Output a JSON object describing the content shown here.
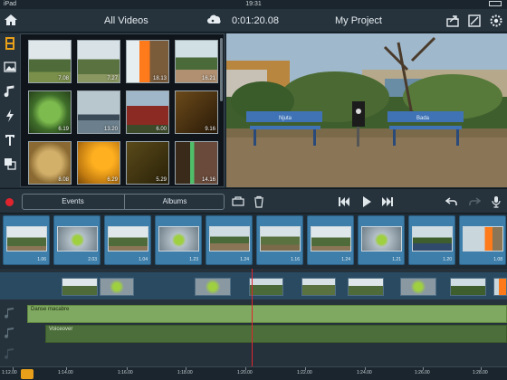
{
  "status": {
    "carrier": "iPad",
    "time": "19:31"
  },
  "titlebar": {
    "library_title": "All Videos",
    "timecode": "0:01:20.08",
    "project_title": "My Project"
  },
  "media": {
    "items": [
      {
        "duration": "7.08"
      },
      {
        "duration": "7.27"
      },
      {
        "duration": "18.13"
      },
      {
        "duration": "16.21"
      },
      {
        "duration": "6.19"
      },
      {
        "duration": "13.20"
      },
      {
        "duration": "6.00"
      },
      {
        "duration": "9.16"
      },
      {
        "duration": "8.08"
      },
      {
        "duration": "6.29"
      },
      {
        "duration": "5.29"
      },
      {
        "duration": "14.16"
      }
    ]
  },
  "preview": {
    "sign_left": "Njuta",
    "sign_right": "Bada"
  },
  "controls": {
    "events_label": "Events",
    "albums_label": "Albums"
  },
  "storyboard": {
    "clips": [
      {
        "duration": "1.06"
      },
      {
        "duration": "2.03"
      },
      {
        "duration": "1.04"
      },
      {
        "duration": "1.23"
      },
      {
        "duration": "1.24"
      },
      {
        "duration": "1.16"
      },
      {
        "duration": "1.24"
      },
      {
        "duration": "1.21"
      },
      {
        "duration": "1.20"
      },
      {
        "duration": "1.08"
      }
    ]
  },
  "timeline": {
    "music_label": "Danse macabre",
    "voice_label": "Voiceover",
    "ruler": [
      "1:12.00",
      "1:14.00",
      "1:16.00",
      "1:18.00",
      "1:20.00",
      "1:22.00",
      "1:24.00",
      "1:26.00",
      "1:28.00"
    ]
  },
  "colors": {
    "accent": "#e8a01a",
    "record": "#e0242e",
    "clip_blue": "#3d7eaa",
    "audio_green": "#7fa960"
  }
}
